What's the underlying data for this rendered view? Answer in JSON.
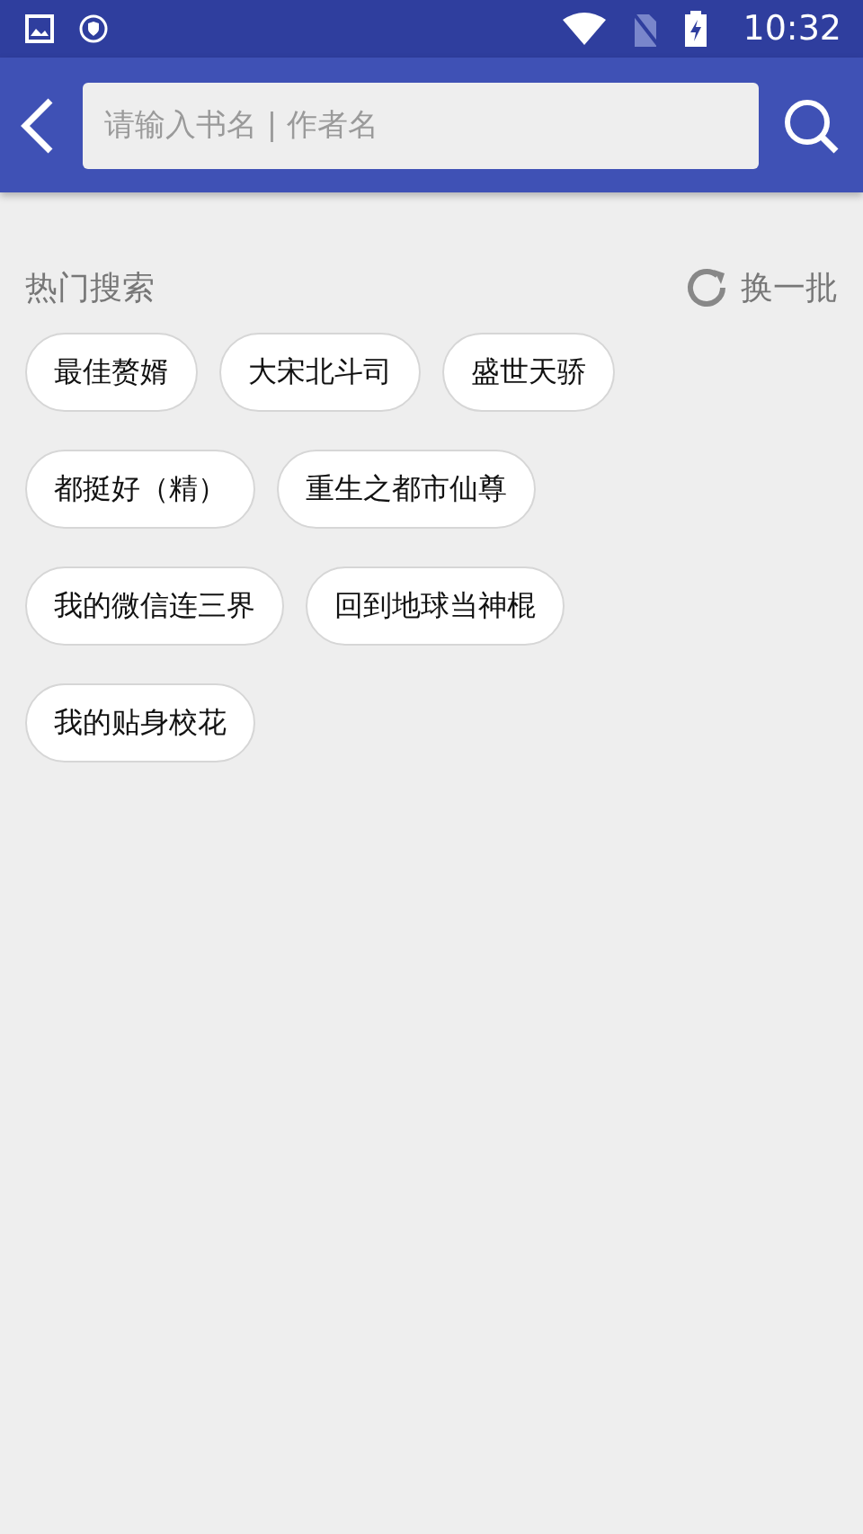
{
  "status_bar": {
    "time": "10:32"
  },
  "search": {
    "placeholder": "请输入书名 | 作者名"
  },
  "hot_search": {
    "title": "热门搜索",
    "refresh": "换一批",
    "rows": [
      [
        "最佳赘婿",
        "大宋北斗司",
        "盛世天骄"
      ],
      [
        "都挺好（精）",
        "重生之都市仙尊"
      ],
      [
        "我的微信连三界",
        "回到地球当神棍"
      ],
      [
        "我的贴身校花"
      ]
    ]
  }
}
